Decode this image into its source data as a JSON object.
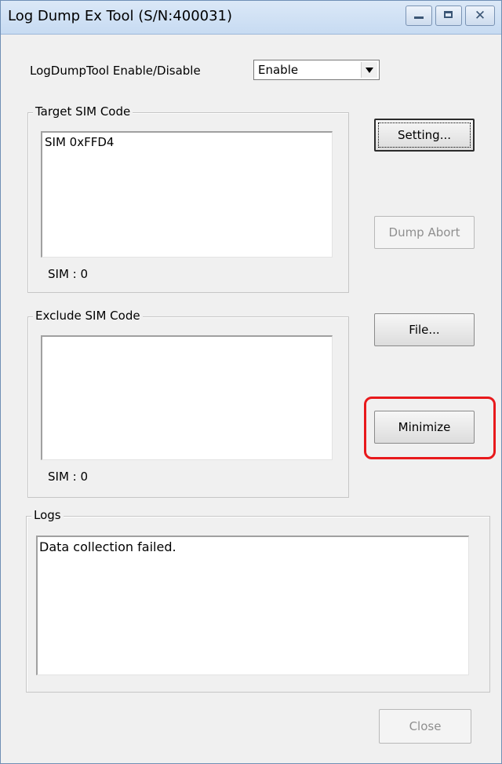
{
  "window": {
    "title": "Log Dump Ex Tool (S/N:400031)",
    "controls": {
      "minimize": "minimize-icon",
      "maximize": "maximize-icon",
      "close": "close-icon"
    }
  },
  "enable_row": {
    "label": "LogDumpTool Enable/Disable",
    "selected": "Enable"
  },
  "target_group": {
    "title": "Target SIM Code",
    "items": [
      "SIM 0xFFD4"
    ],
    "count_text": "SIM : 0"
  },
  "exclude_group": {
    "title": "Exclude SIM Code",
    "items": [],
    "count_text": "SIM : 0"
  },
  "logs_group": {
    "title": "Logs",
    "text": "Data collection failed."
  },
  "buttons": {
    "setting": "Setting...",
    "dump_abort": "Dump Abort",
    "file": "File...",
    "minimize": "Minimize",
    "close": "Close"
  },
  "colors": {
    "highlight": "#e8191c",
    "window_bg": "#f0f0f0",
    "disabled_text": "#8f8f8f"
  }
}
